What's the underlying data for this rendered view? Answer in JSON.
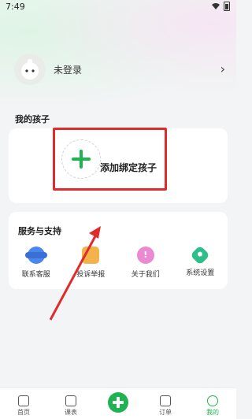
{
  "status_bar": {
    "time": "7:49"
  },
  "profile": {
    "login_text": "未登录"
  },
  "kids": {
    "title": "我的孩子",
    "add_label": "添加绑定孩子"
  },
  "services": {
    "title": "服务与支持",
    "items": [
      {
        "label": "联系客服",
        "icon": "headset-icon"
      },
      {
        "label": "投诉举报",
        "icon": "complaint-icon"
      },
      {
        "label": "关于我们",
        "icon": "info-icon"
      },
      {
        "label": "系统设置",
        "icon": "settings-icon"
      }
    ]
  },
  "tab_bar": {
    "items": [
      {
        "label": "首页",
        "icon": "home-icon"
      },
      {
        "label": "课表",
        "icon": "calendar-icon"
      },
      {
        "label": "",
        "icon": "add-icon"
      },
      {
        "label": "订单",
        "icon": "order-icon"
      },
      {
        "label": "我的",
        "icon": "profile-icon"
      }
    ],
    "active": "我的"
  },
  "colors": {
    "accent": "#1fb352",
    "highlight_box": "#e02b2b"
  }
}
